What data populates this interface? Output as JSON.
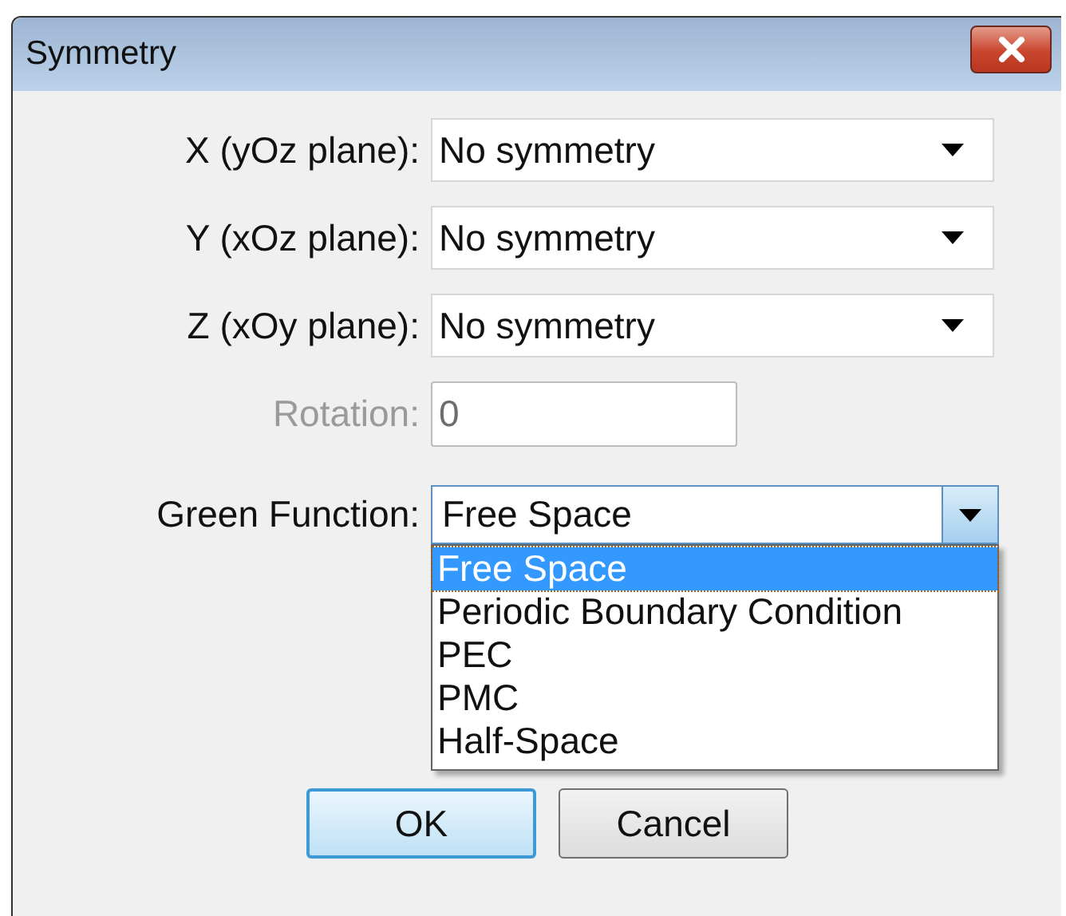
{
  "window": {
    "title": "Symmetry"
  },
  "fields": [
    {
      "kind": "combo",
      "label": "X (yOz plane):",
      "value": "No symmetry",
      "disabled": false
    },
    {
      "kind": "combo",
      "label": "Y (xOz plane):",
      "value": "No symmetry",
      "disabled": false
    },
    {
      "kind": "combo",
      "label": "Z (xOy plane):",
      "value": "No symmetry",
      "disabled": false
    },
    {
      "kind": "text",
      "label": "Rotation:",
      "value": "0",
      "disabled": true
    },
    {
      "kind": "combo",
      "label": "Green Function:",
      "value": "Free Space",
      "disabled": false,
      "expanded": true,
      "options": [
        {
          "label": "Free Space",
          "selected": true
        },
        {
          "label": "Periodic Boundary Condition",
          "selected": false
        },
        {
          "label": "PEC",
          "selected": false
        },
        {
          "label": "PMC",
          "selected": false
        },
        {
          "label": "Half-Space",
          "selected": false
        }
      ]
    }
  ],
  "buttons": [
    {
      "label": "OK",
      "default": true
    },
    {
      "label": "Cancel",
      "default": false
    }
  ]
}
